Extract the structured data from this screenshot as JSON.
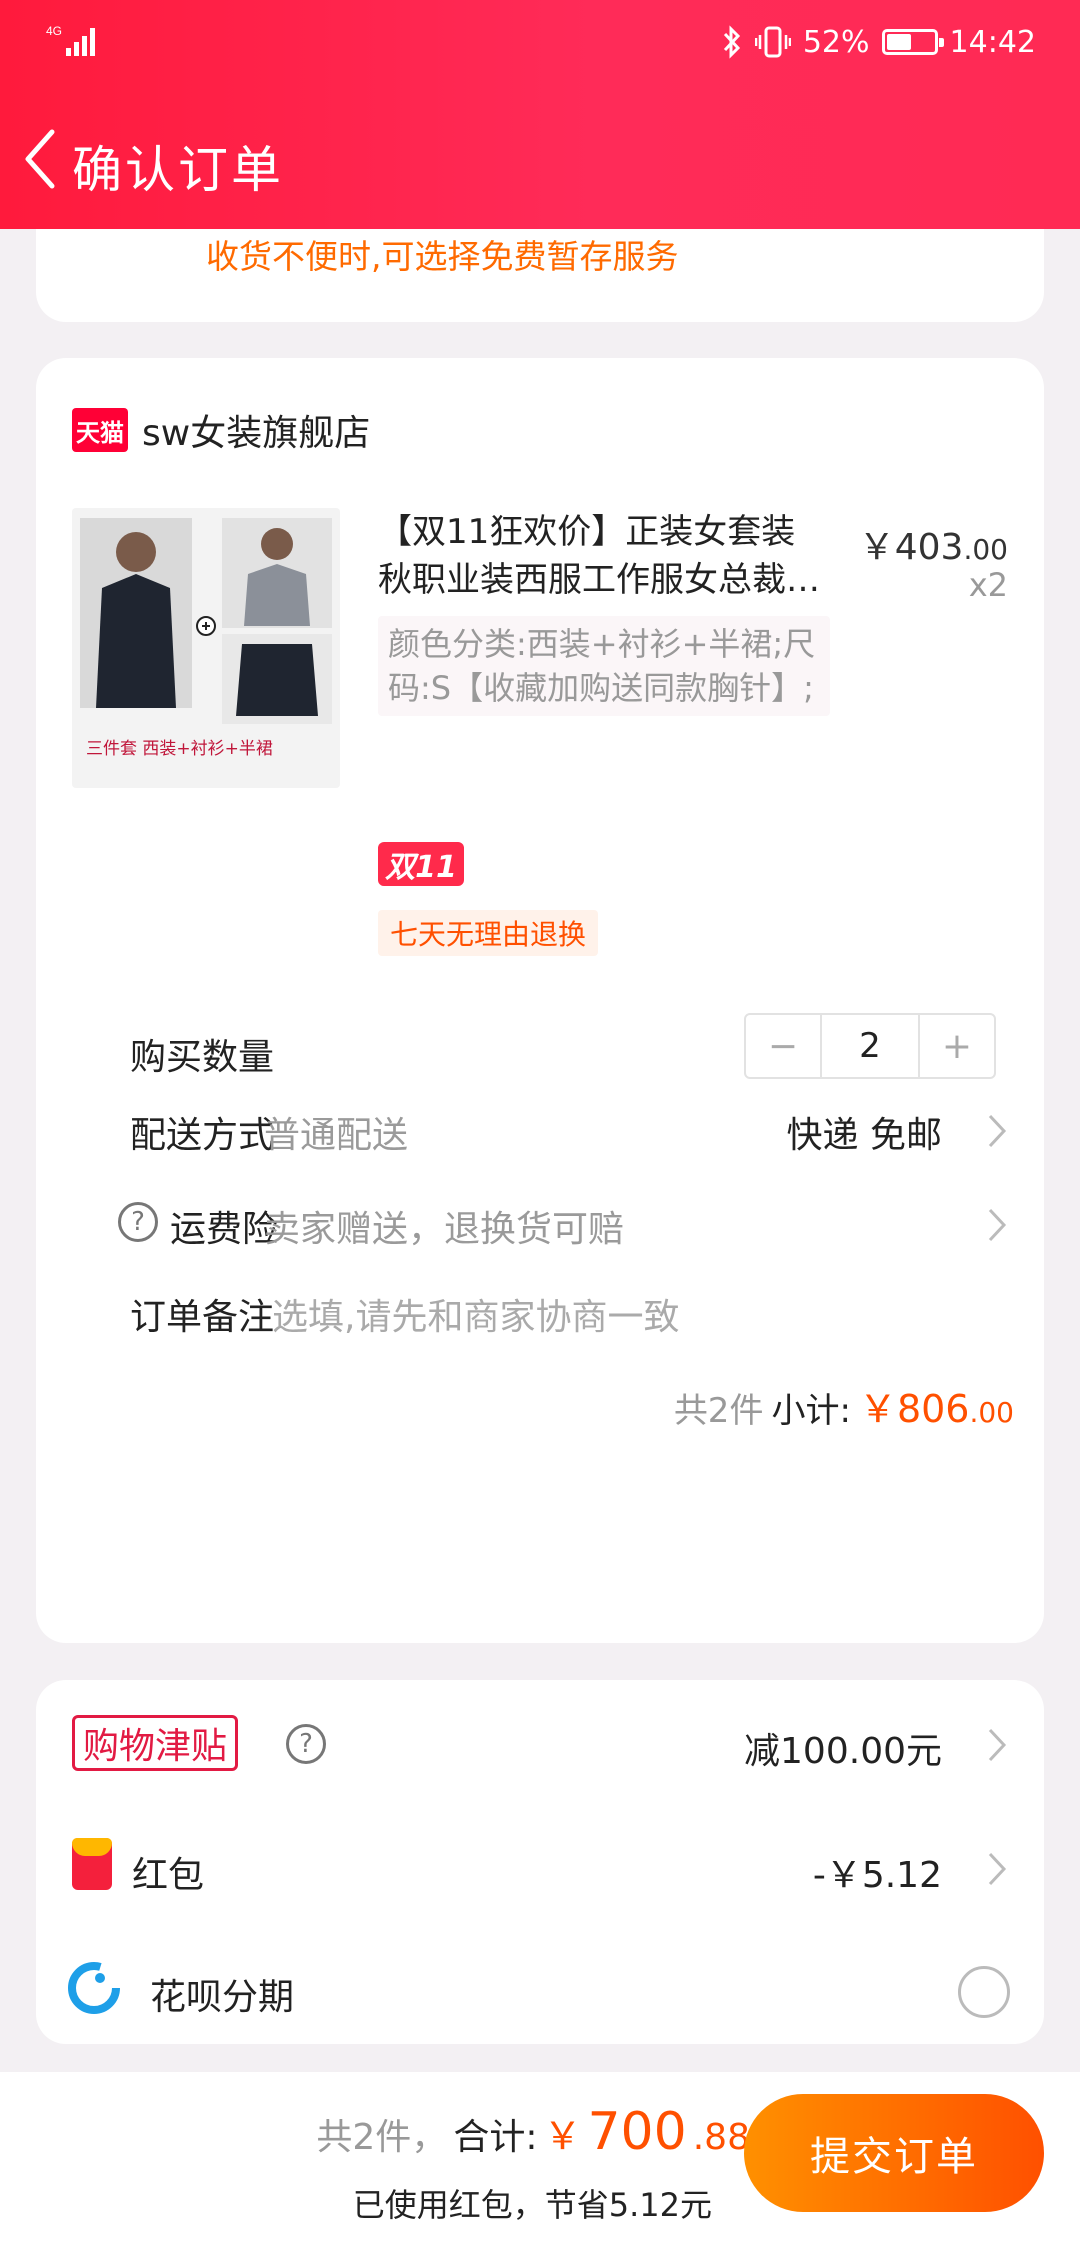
{
  "status_bar": {
    "network": "4G",
    "battery_text": "52%",
    "battery_level": 0.52,
    "time": "14:42"
  },
  "nav": {
    "title": "确认订单"
  },
  "notice": {
    "text": "收货不便时,可选择免费暂存服务"
  },
  "shop": {
    "badge": "天猫",
    "name": "sw女装旗舰店"
  },
  "product": {
    "image_label": "三件套   西装+衬衫+半裙",
    "title_line1": "【双11狂欢价】正装女套装",
    "title_line2": "秋职业装西服工作服女总裁…",
    "price_currency": "￥",
    "price_int": "403",
    "price_dec": ".00",
    "quantity_badge": "x2",
    "sku": "颜色分类:西装+衬衫+半裙;尺码:S【收藏加购送同款胸针】;",
    "promo_badge": "双11",
    "return_tag": "七天无理由退换"
  },
  "rows": {
    "quantity_label": "购买数量",
    "quantity_value": "2",
    "minus": "−",
    "plus": "+",
    "delivery_label": "配送方式",
    "delivery_value": "普通配送",
    "delivery_detail": "快递 免邮",
    "insurance_label": "运费险",
    "insurance_value": "卖家赠送，退换货可赔",
    "remark_label": "订单备注",
    "remark_placeholder": "选填,请先和商家协商一致"
  },
  "subtotal": {
    "count": "共2件",
    "label": "小计:",
    "currency": "￥",
    "amount_int": "806",
    "amount_dec": ".00"
  },
  "benefits": {
    "jintie_label": "购物津贴",
    "jintie_value": "减100.00元",
    "hongbao_label": "红包",
    "hongbao_value": "-￥5.12",
    "huabei_label": "花呗分期"
  },
  "footer": {
    "count": "共2件，",
    "total_label": "合计:",
    "currency": "￥",
    "total_int": "700",
    "total_dec": ".88",
    "saving_note": "已使用红包，节省5.12元",
    "submit_label": "提交订单"
  },
  "colors": {
    "header": "#ff1a3c",
    "accent": "#ff5000",
    "tmall": "#ff0036"
  }
}
